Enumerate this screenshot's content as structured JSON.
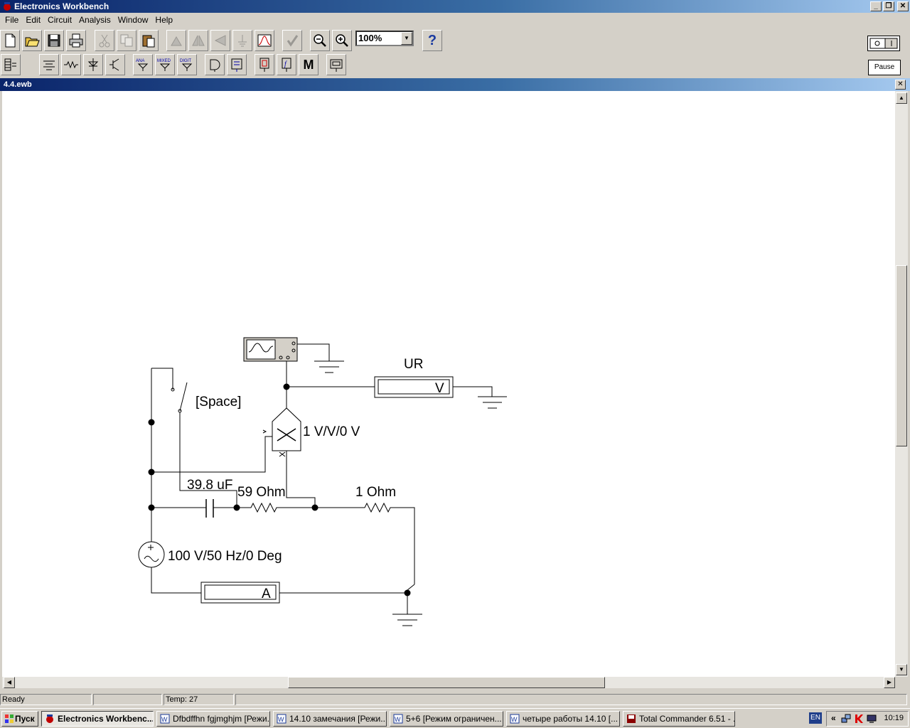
{
  "app": {
    "title": "Electronics Workbench",
    "win_buttons": [
      "_",
      "❐",
      "✕"
    ]
  },
  "menu": [
    "File",
    "Edit",
    "Circuit",
    "Analysis",
    "Window",
    "Help"
  ],
  "toolbar": {
    "zoom_value": "100%",
    "help_label": "?",
    "pause_label": "Pause",
    "power_label": "O I",
    "bin_labels": [
      "ANA",
      "MIXED",
      "DIGIT"
    ],
    "math_label": "M"
  },
  "document": {
    "title": "4.4.ewb",
    "close": "✕"
  },
  "circuit": {
    "voltmeter_name": "UR",
    "voltmeter_unit": "V",
    "ammeter_unit": "A",
    "switch_key": "[Space]",
    "multiplier_value": "1 V/V/0 V",
    "capacitor_value": "39.8 uF",
    "resistor1_value": "59  Ohm",
    "resistor2_value": "1  Ohm",
    "source_value": "100 V/50 Hz/0 Deg"
  },
  "status": {
    "ready": "Ready",
    "empty": "",
    "temp": "Temp:  27"
  },
  "taskbar": {
    "start": "Пуск",
    "tasks": [
      "Electronics Workbenc...",
      "Dfbdffhn fgjmghjm [Режи...",
      "14.10 замечания [Режи...",
      "5+6 [Режим ограничен...",
      "четыре работы 14.10 [...",
      "Total Commander 6.51 - ..."
    ],
    "lang": "EN",
    "tray_arrow": "«",
    "clock": "10:19"
  }
}
